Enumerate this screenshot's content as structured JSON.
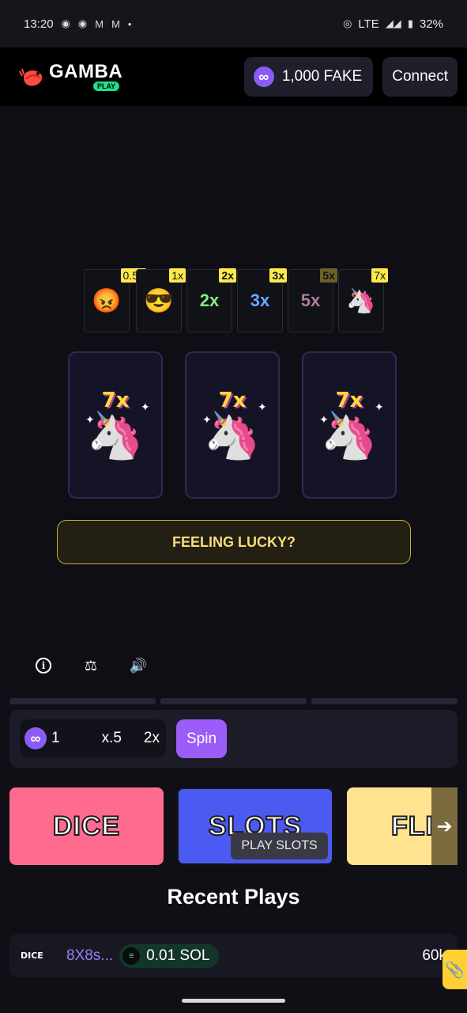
{
  "status_bar": {
    "time": "13:20",
    "network": "LTE",
    "battery": "32%",
    "notification_icons": [
      "discord-icon",
      "discord-icon",
      "gmail-icon",
      "gmail-icon",
      "dot-icon"
    ]
  },
  "header": {
    "logo_text": "GAMBA",
    "logo_badge": "PLAY",
    "balance": "1,000 FAKE",
    "connect_label": "Connect"
  },
  "slots": {
    "multipliers": [
      {
        "label": "0.5x",
        "icon": "angry-face-icon",
        "emoji": "😡",
        "highlight": true
      },
      {
        "label": "1x",
        "icon": "sunglasses-face-icon",
        "emoji": "😎",
        "highlight": true
      },
      {
        "label": "2x",
        "icon": "2x-icon",
        "emoji": "2x",
        "highlight": true
      },
      {
        "label": "3x",
        "icon": "3x-icon",
        "emoji": "3x",
        "highlight": true
      },
      {
        "label": "5x",
        "icon": "5x-icon",
        "emoji": "5x",
        "highlight": false
      },
      {
        "label": "7x",
        "icon": "unicorn-icon",
        "emoji": "🦄",
        "highlight": true
      }
    ],
    "reels": [
      {
        "label": "7x",
        "icon": "unicorn-icon",
        "emoji": "🦄"
      },
      {
        "label": "7x",
        "icon": "unicorn-icon",
        "emoji": "🦄"
      },
      {
        "label": "7x",
        "icon": "unicorn-icon",
        "emoji": "🦄"
      }
    ],
    "lucky_label": "FEELING LUCKY?"
  },
  "toolbar": {
    "icons": [
      "info-icon",
      "scale-icon",
      "volume-icon"
    ]
  },
  "controls": {
    "wager_value": "1",
    "halve_label": "x.5",
    "double_label": "2x",
    "spin_label": "Spin"
  },
  "games": [
    {
      "name": "DICE"
    },
    {
      "name": "SLOTS"
    },
    {
      "name": "FLIP"
    }
  ],
  "play_label": "PLAY SLOTS",
  "recent": {
    "title": "Recent Plays",
    "rows": [
      {
        "game": "DICE",
        "player": "8X8s...",
        "amount": "0.01 SOL",
        "payout": "60k"
      }
    ]
  },
  "colors": {
    "accent": "#9b5cf7",
    "gold": "#ffe94a",
    "dice": "#ff6b8e",
    "slots": "#4b5af0",
    "flip": "#ffe38f"
  }
}
